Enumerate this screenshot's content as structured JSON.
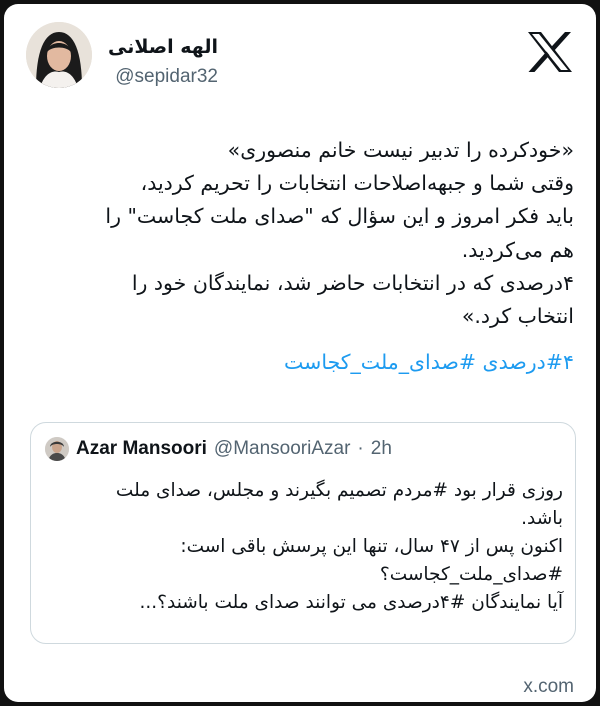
{
  "author": {
    "name": "الهه اصلانی",
    "handle": "@sepidar32"
  },
  "tweet": {
    "text": "«خودکرده را تدبیر نیست خانم منصوری»\nوقتی شما و جبهه‌اصلاحات انتخابات را تحریم کردید،\nباید فکر امروز و این سؤال که \"صدای ملت کجاست\" را\nهم می‌کردید.\n۴درصدی که در انتخابات حاضر شد، نمایندگان خود را\nانتخاب کرد.»",
    "hashtags": "#۴درصدی #صدای_ملت_کجاست"
  },
  "quote": {
    "name": "Azar Mansoori",
    "handle": "@MansooriAzar",
    "dot": "·",
    "time": "2h",
    "text": "روزی قرار بود #مردم تصمیم بگیرند و مجلس، صدای ملت\nباشد.\nاکنون پس از ۴۷ سال، تنها این پرسش باقی است:\n#صدای_ملت_کجاست؟\nآیا نمایندگان #۴درصدی می توانند صدای ملت باشند؟..."
  },
  "footer": {
    "source": "x.com"
  },
  "icons": {
    "brand": "x-logo-icon"
  },
  "colors": {
    "hashtag": "#1d9bf0",
    "muted": "#536471",
    "text": "#0f1419"
  }
}
